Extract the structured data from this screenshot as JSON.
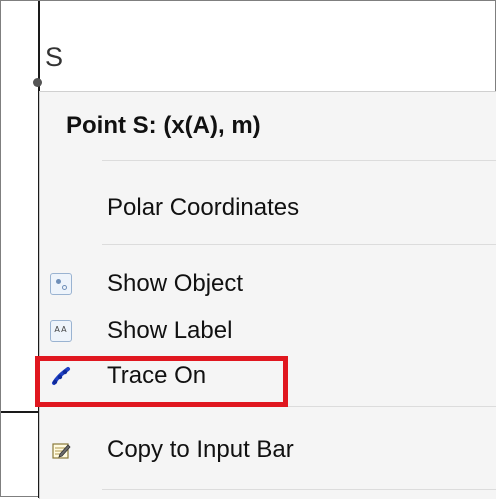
{
  "canvas": {
    "point_label": "S"
  },
  "context_menu": {
    "title": "Point S: (x(A), m)",
    "items": [
      {
        "label": "Polar Coordinates",
        "icon": null
      },
      {
        "label": "Show Object",
        "icon": "show-object-icon"
      },
      {
        "label": "Show Label",
        "icon": "show-label-icon"
      },
      {
        "label": "Trace On",
        "icon": "trace-pen-icon"
      },
      {
        "label": "Copy to Input Bar",
        "icon": "copy-to-input-bar-icon"
      }
    ]
  },
  "show_label_icon_text": "AA",
  "colors": {
    "highlight": "#e0171f",
    "menu_background": "#f5f5f5",
    "trace_icon": "#1f3fc4"
  }
}
